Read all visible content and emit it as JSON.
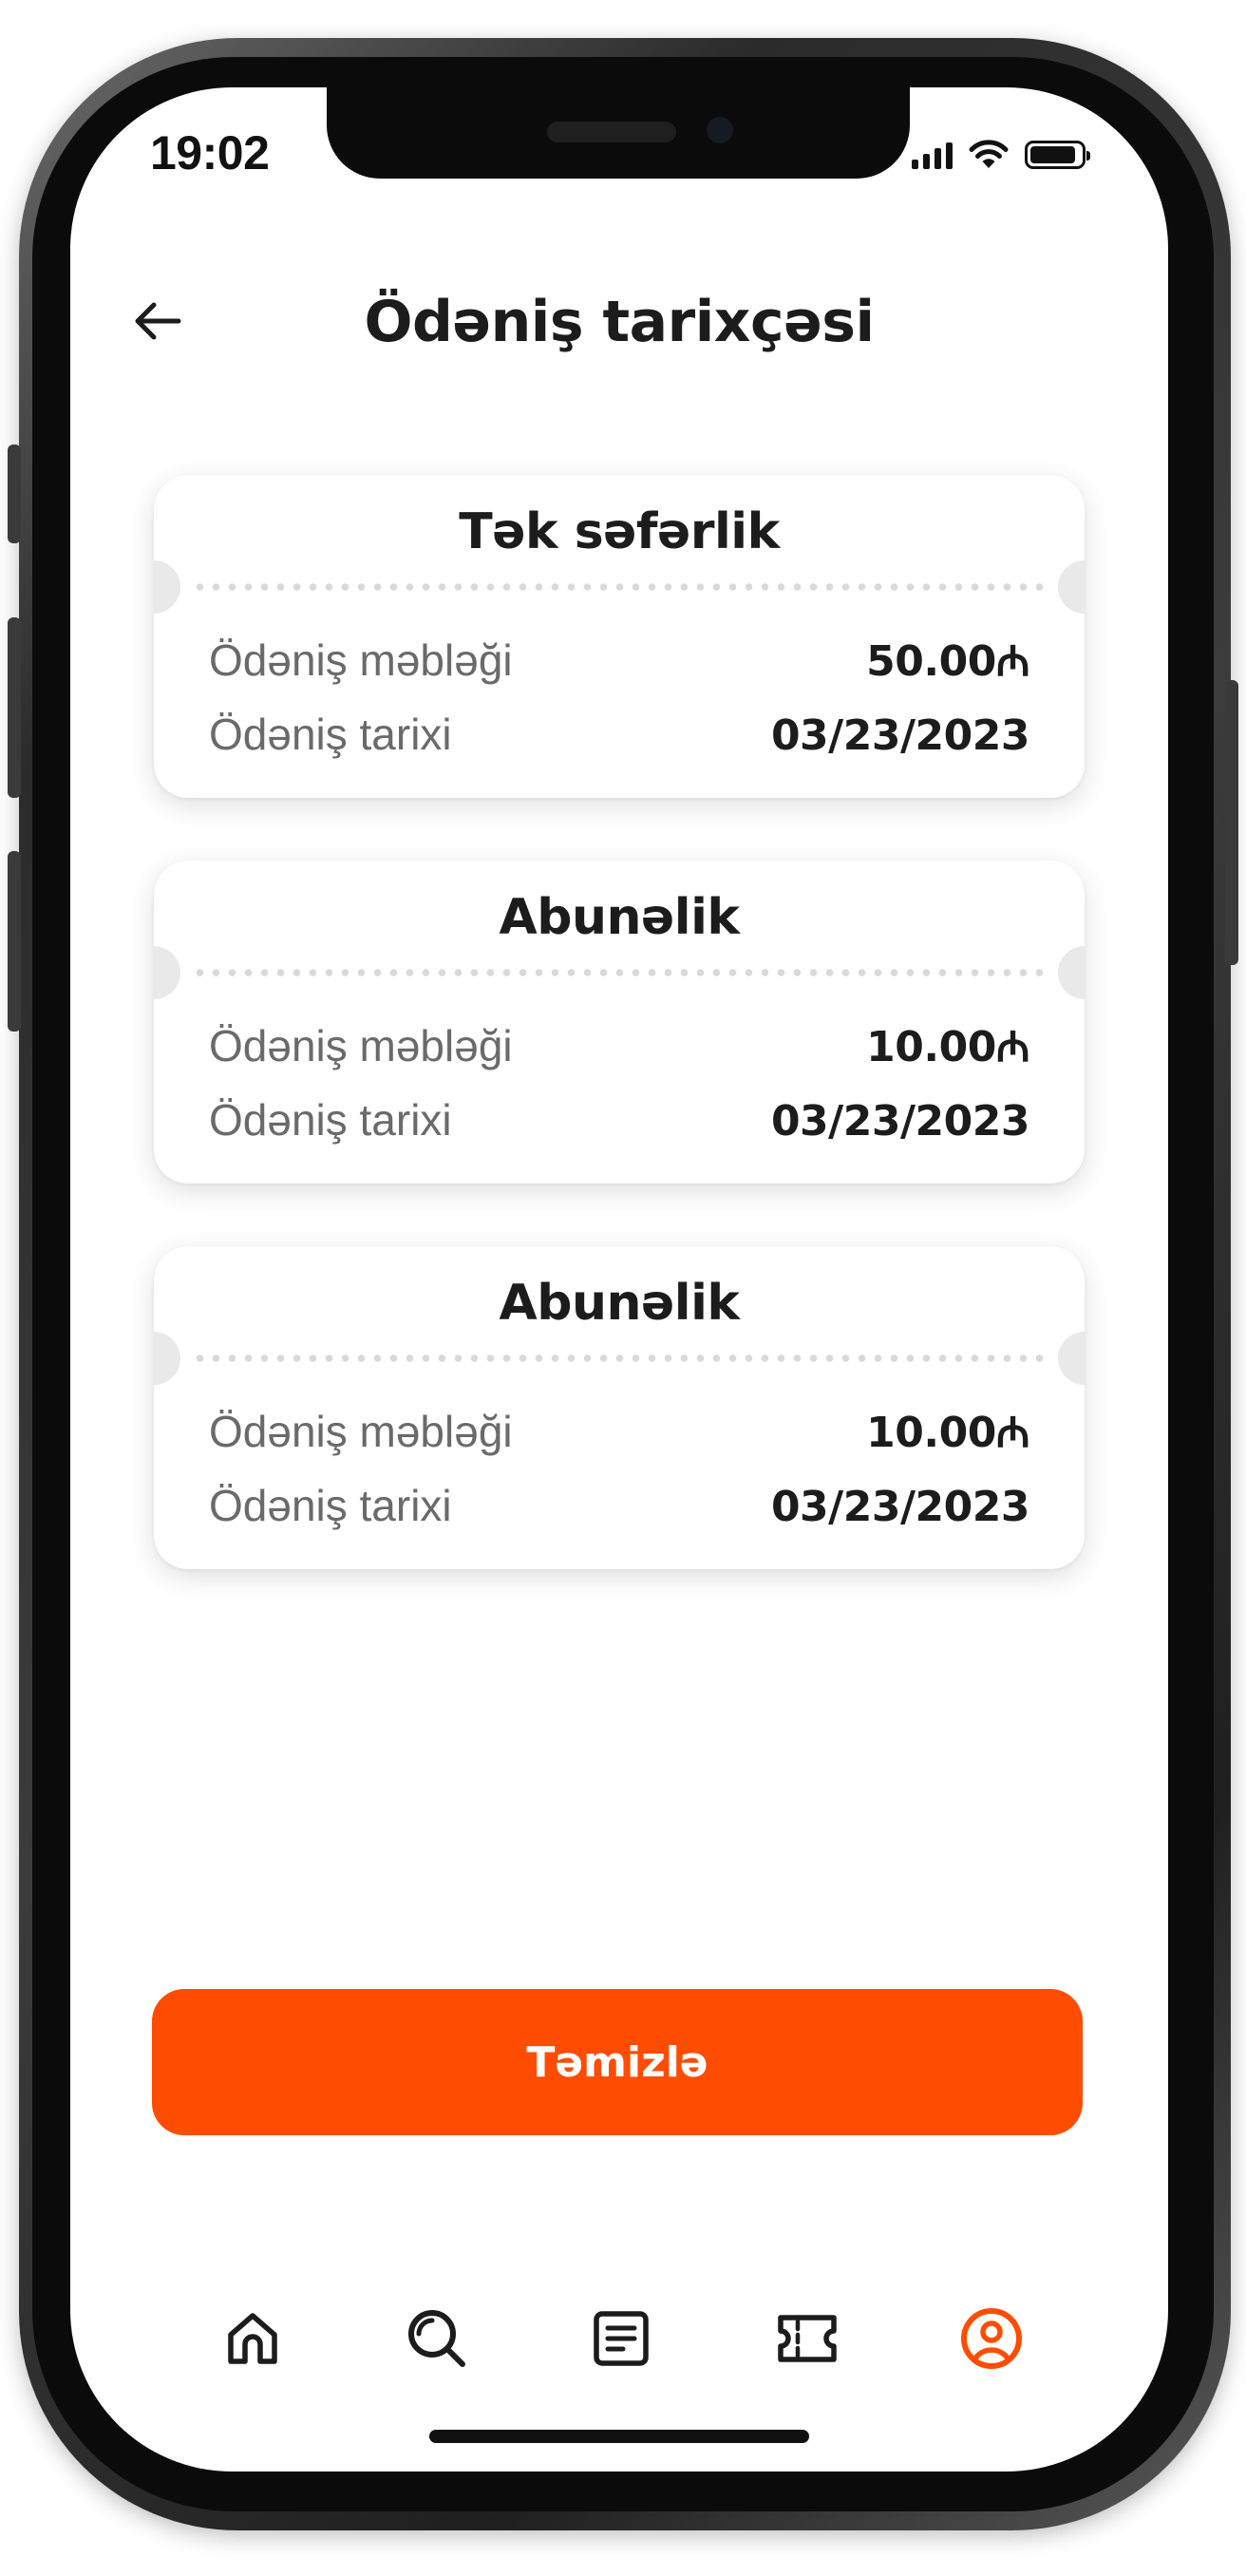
{
  "status_bar": {
    "time": "19:02",
    "signal_icon": "cellular-signal-icon",
    "wifi_icon": "wifi-icon",
    "battery_icon": "battery-icon",
    "battery_level": 0.9
  },
  "header": {
    "back_icon": "arrow-left-icon",
    "title": "Ödəniş tarixçəsi"
  },
  "payments": [
    {
      "type": "Tək səfərlik",
      "amount_label": "Ödəniş məbləği",
      "amount": "50.00₼",
      "date_label": "Ödəniş tarixi",
      "date": "03/23/2023"
    },
    {
      "type": "Abunəlik",
      "amount_label": "Ödəniş məbləği",
      "amount": "10.00₼",
      "date_label": "Ödəniş tarixi",
      "date": "03/23/2023"
    },
    {
      "type": "Abunəlik",
      "amount_label": "Ödəniş məbləği",
      "amount": "10.00₼",
      "date_label": "Ödəniş tarixi",
      "date": "03/23/2023"
    }
  ],
  "actions": {
    "clear_label": "Təmizlə"
  },
  "bottom_nav": {
    "items": [
      {
        "icon": "home-icon",
        "active": false
      },
      {
        "icon": "search-icon",
        "active": false
      },
      {
        "icon": "document-list-icon",
        "active": false
      },
      {
        "icon": "ticket-icon",
        "active": false
      },
      {
        "icon": "user-profile-icon",
        "active": true
      }
    ]
  },
  "colors": {
    "accent": "#fe4c02",
    "text_primary": "#1c1c1c",
    "text_secondary": "#6a6a6a",
    "nav_icon": "#1c1c1c",
    "divider_dots": "#d9d9d9",
    "background": "#ffffff"
  }
}
